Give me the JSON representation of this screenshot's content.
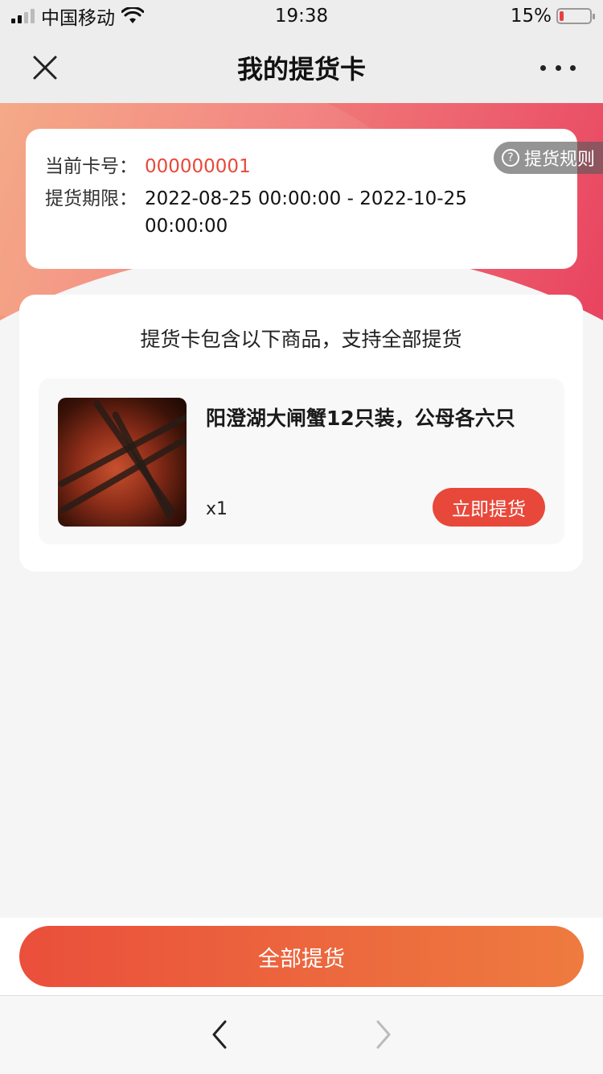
{
  "status_bar": {
    "carrier": "中国移动",
    "time": "19:38",
    "battery_percent": "15%",
    "battery_level": 0.15,
    "battery_color": "#e84040",
    "signal_bars_filled": 2
  },
  "nav": {
    "title": "我的提货卡",
    "close_icon": "close-icon",
    "more_icon": "more-icon"
  },
  "card_info": {
    "card_number_label": "当前卡号：",
    "card_number": "000000001",
    "period_label": "提货期限：",
    "period_value": "2022-08-25 00:00:00 - 2022-10-25 00:00:00",
    "rules_label": "提货规则"
  },
  "goods": {
    "heading": "提货卡包含以下商品，支持全部提货",
    "items": [
      {
        "name": "阳澄湖大闸蟹12只装，公母各六只",
        "quantity": "x1",
        "action_label": "立即提货"
      }
    ]
  },
  "bottom": {
    "all_pickup_label": "全部提货"
  },
  "colors": {
    "accent": "#e8483a",
    "gradient_start": "#f4a37d",
    "gradient_end": "#e83d5c"
  }
}
